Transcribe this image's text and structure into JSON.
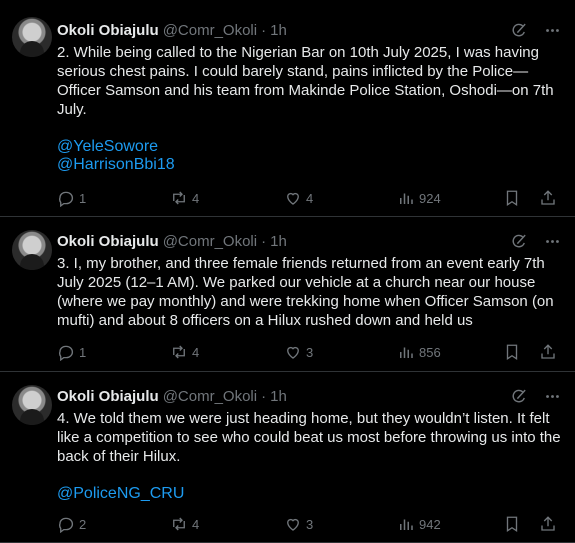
{
  "tweets": [
    {
      "name": "Okoli Obiajulu",
      "handle": "@Comr_Okoli",
      "time": "1h",
      "text": "2. While being called to the Nigerian Bar on 10th July 2025, I was having serious chest pains. I could barely stand, pains inflicted by the Police—Officer Samson and his team from Makinde Police Station, Oshodi—on 7th July.",
      "mentions": [
        "@YeleSowore",
        "@HarrisonBbi18"
      ],
      "replies": "1",
      "reposts": "4",
      "likes": "4",
      "views": "924"
    },
    {
      "name": "Okoli Obiajulu",
      "handle": "@Comr_Okoli",
      "time": "1h",
      "text": "3. I, my brother, and three female friends returned from an event early 7th July 2025 (12–1 AM). We parked our vehicle at a church near our house (where we pay monthly) and were trekking home when Officer Samson (on mufti) and about 8 officers on a Hilux rushed down and held us",
      "mentions": [],
      "replies": "1",
      "reposts": "4",
      "likes": "3",
      "views": "856"
    },
    {
      "name": "Okoli Obiajulu",
      "handle": "@Comr_Okoli",
      "time": "1h",
      "text": "4. We told them we were just heading home, but they wouldn’t listen. It felt like a competition to see who could beat us most before throwing us into the back of their Hilux.",
      "mentions": [
        "@PoliceNG_CRU"
      ],
      "replies": "2",
      "reposts": "4",
      "likes": "3",
      "views": "942"
    }
  ],
  "icons": {
    "grok": "grok-icon",
    "more": "more-icon",
    "reply": "reply-icon",
    "repost": "repost-icon",
    "like": "like-icon",
    "views": "views-icon",
    "bookmark": "bookmark-icon",
    "share": "share-icon"
  },
  "colors": {
    "background": "#000000",
    "text": "#e7e9ea",
    "muted": "#71767b",
    "link": "#1d9bf0",
    "divider": "#2f3336"
  }
}
